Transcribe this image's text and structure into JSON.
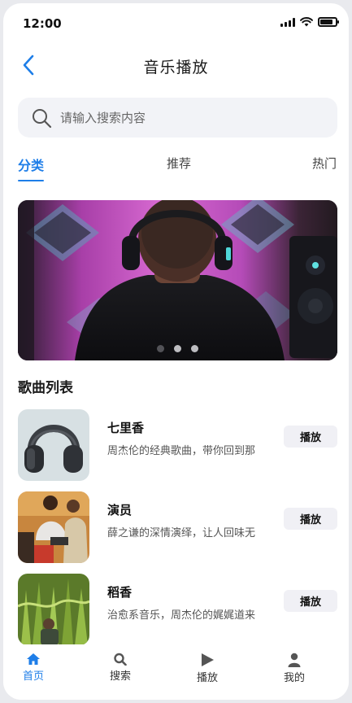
{
  "status_bar": {
    "time": "12:00"
  },
  "header": {
    "title": "音乐播放",
    "back_icon": "chevron-left-icon"
  },
  "search": {
    "placeholder": "请输入搜索内容",
    "value": ""
  },
  "tabs": [
    {
      "label": "分类",
      "active": true
    },
    {
      "label": "推荐",
      "active": false
    },
    {
      "label": "热门",
      "active": false
    }
  ],
  "banner": {
    "slide_count": 3,
    "current_slide": 1
  },
  "section": {
    "title": "歌曲列表"
  },
  "songs": [
    {
      "name": "七里香",
      "description": "周杰伦的经典歌曲，带你回到那",
      "action": "播放"
    },
    {
      "name": "演员",
      "description": "薛之谦的深情演绎，让人回味无",
      "action": "播放"
    },
    {
      "name": "稻香",
      "description": "治愈系音乐，周杰伦的娓娓道来",
      "action": "播放"
    }
  ],
  "bottom_nav": [
    {
      "label": "首页",
      "icon": "home-icon",
      "active": true
    },
    {
      "label": "搜索",
      "icon": "search-icon",
      "active": false
    },
    {
      "label": "播放",
      "icon": "play-icon",
      "active": false
    },
    {
      "label": "我的",
      "icon": "user-icon",
      "active": false
    }
  ],
  "colors": {
    "accent": "#1e7ee8",
    "search_bg": "#f2f3f7",
    "button_bg": "#f0f0f5"
  }
}
